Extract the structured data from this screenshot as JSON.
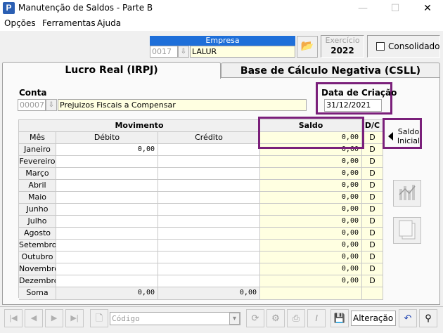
{
  "window": {
    "title": "Manutenção de Saldos - Parte B",
    "minimize": "—",
    "maximize": "☐",
    "close": "✕"
  },
  "menu": [
    "Opções",
    "Ferramentas",
    "Ajuda"
  ],
  "empresa": {
    "label": "Empresa",
    "code": "0017",
    "name": "LALUR"
  },
  "exercicio": {
    "label": "Exercício",
    "value": "2022"
  },
  "consolidado": {
    "label": "Consolidado",
    "checked": false
  },
  "tabs": [
    {
      "label": "Lucro Real (IRPJ)",
      "active": true
    },
    {
      "label": "Base de Cálculo Negativa (CSLL)",
      "active": false
    }
  ],
  "conta": {
    "label": "Conta",
    "code": "00007",
    "name": "Prejuizos Fiscais a Compensar"
  },
  "data_criacao": {
    "label": "Data de Criação",
    "value": "31/12/2021"
  },
  "grid": {
    "header_movimento": "Movimento",
    "header_saldo": "Saldo",
    "header_dc": "D/C",
    "col_mes": "Mês",
    "col_debito": "Débito",
    "col_credito": "Crédito",
    "saldo_inicial_value": "0,00",
    "saldo_inicial_dc": "D",
    "saldo_inicial_label": "Saldo Inicial",
    "rows": [
      {
        "mes": "Janeiro",
        "debito": "0,00",
        "credito": "",
        "saldo": "0,00",
        "dc": "D"
      },
      {
        "mes": "Fevereiro",
        "debito": "",
        "credito": "",
        "saldo": "0,00",
        "dc": "D"
      },
      {
        "mes": "Março",
        "debito": "",
        "credito": "",
        "saldo": "0,00",
        "dc": "D"
      },
      {
        "mes": "Abril",
        "debito": "",
        "credito": "",
        "saldo": "0,00",
        "dc": "D"
      },
      {
        "mes": "Maio",
        "debito": "",
        "credito": "",
        "saldo": "0,00",
        "dc": "D"
      },
      {
        "mes": "Junho",
        "debito": "",
        "credito": "",
        "saldo": "0,00",
        "dc": "D"
      },
      {
        "mes": "Julho",
        "debito": "",
        "credito": "",
        "saldo": "0,00",
        "dc": "D"
      },
      {
        "mes": "Agosto",
        "debito": "",
        "credito": "",
        "saldo": "0,00",
        "dc": "D"
      },
      {
        "mes": "Setembro",
        "debito": "",
        "credito": "",
        "saldo": "0,00",
        "dc": "D"
      },
      {
        "mes": "Outubro",
        "debito": "",
        "credito": "",
        "saldo": "0,00",
        "dc": "D"
      },
      {
        "mes": "Novembro",
        "debito": "",
        "credito": "",
        "saldo": "0,00",
        "dc": "D"
      },
      {
        "mes": "Dezembro",
        "debito": "",
        "credito": "",
        "saldo": "0,00",
        "dc": "D"
      }
    ],
    "soma_label": "Soma",
    "soma_debito": "0,00",
    "soma_credito": "0,00"
  },
  "statusbar": {
    "codigo_placeholder": "Código",
    "mode": "Alteração"
  },
  "colors": {
    "highlight": "#7a1f7a",
    "empresa_header": "#1e6fd9",
    "yellow_field": "#ffffe1"
  }
}
